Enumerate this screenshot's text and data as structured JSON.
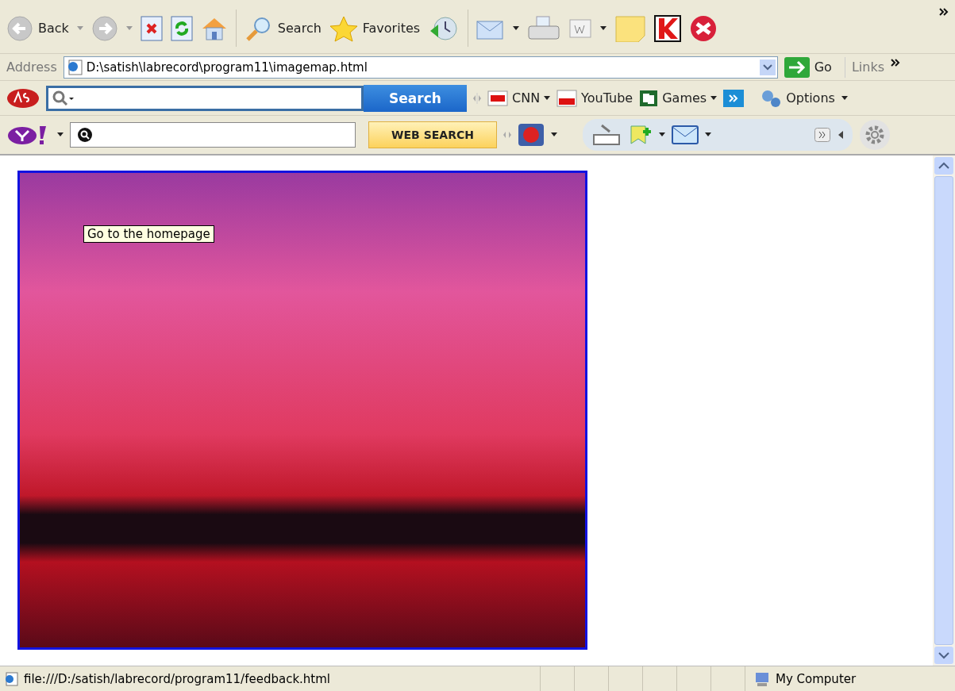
{
  "toolbar": {
    "back_label": "Back",
    "search_label": "Search",
    "favorites_label": "Favorites"
  },
  "address_bar": {
    "label": "Address",
    "value": "D:\\satish\\labrecord\\program11\\imagemap.html",
    "go_label": "Go",
    "links_label": "Links"
  },
  "ask_toolbar": {
    "search_button": "Search",
    "links": [
      {
        "label": "CNN",
        "dropdown": true
      },
      {
        "label": "YouTube",
        "dropdown": false
      },
      {
        "label": "Games",
        "dropdown": true
      }
    ],
    "options_label": "Options"
  },
  "yahoo_toolbar": {
    "search_button": "WEB SEARCH"
  },
  "page": {
    "tooltip": "Go to the homepage"
  },
  "status_bar": {
    "text": "file:///D:/satish/labrecord/program11/feedback.html",
    "zone": "My Computer"
  }
}
